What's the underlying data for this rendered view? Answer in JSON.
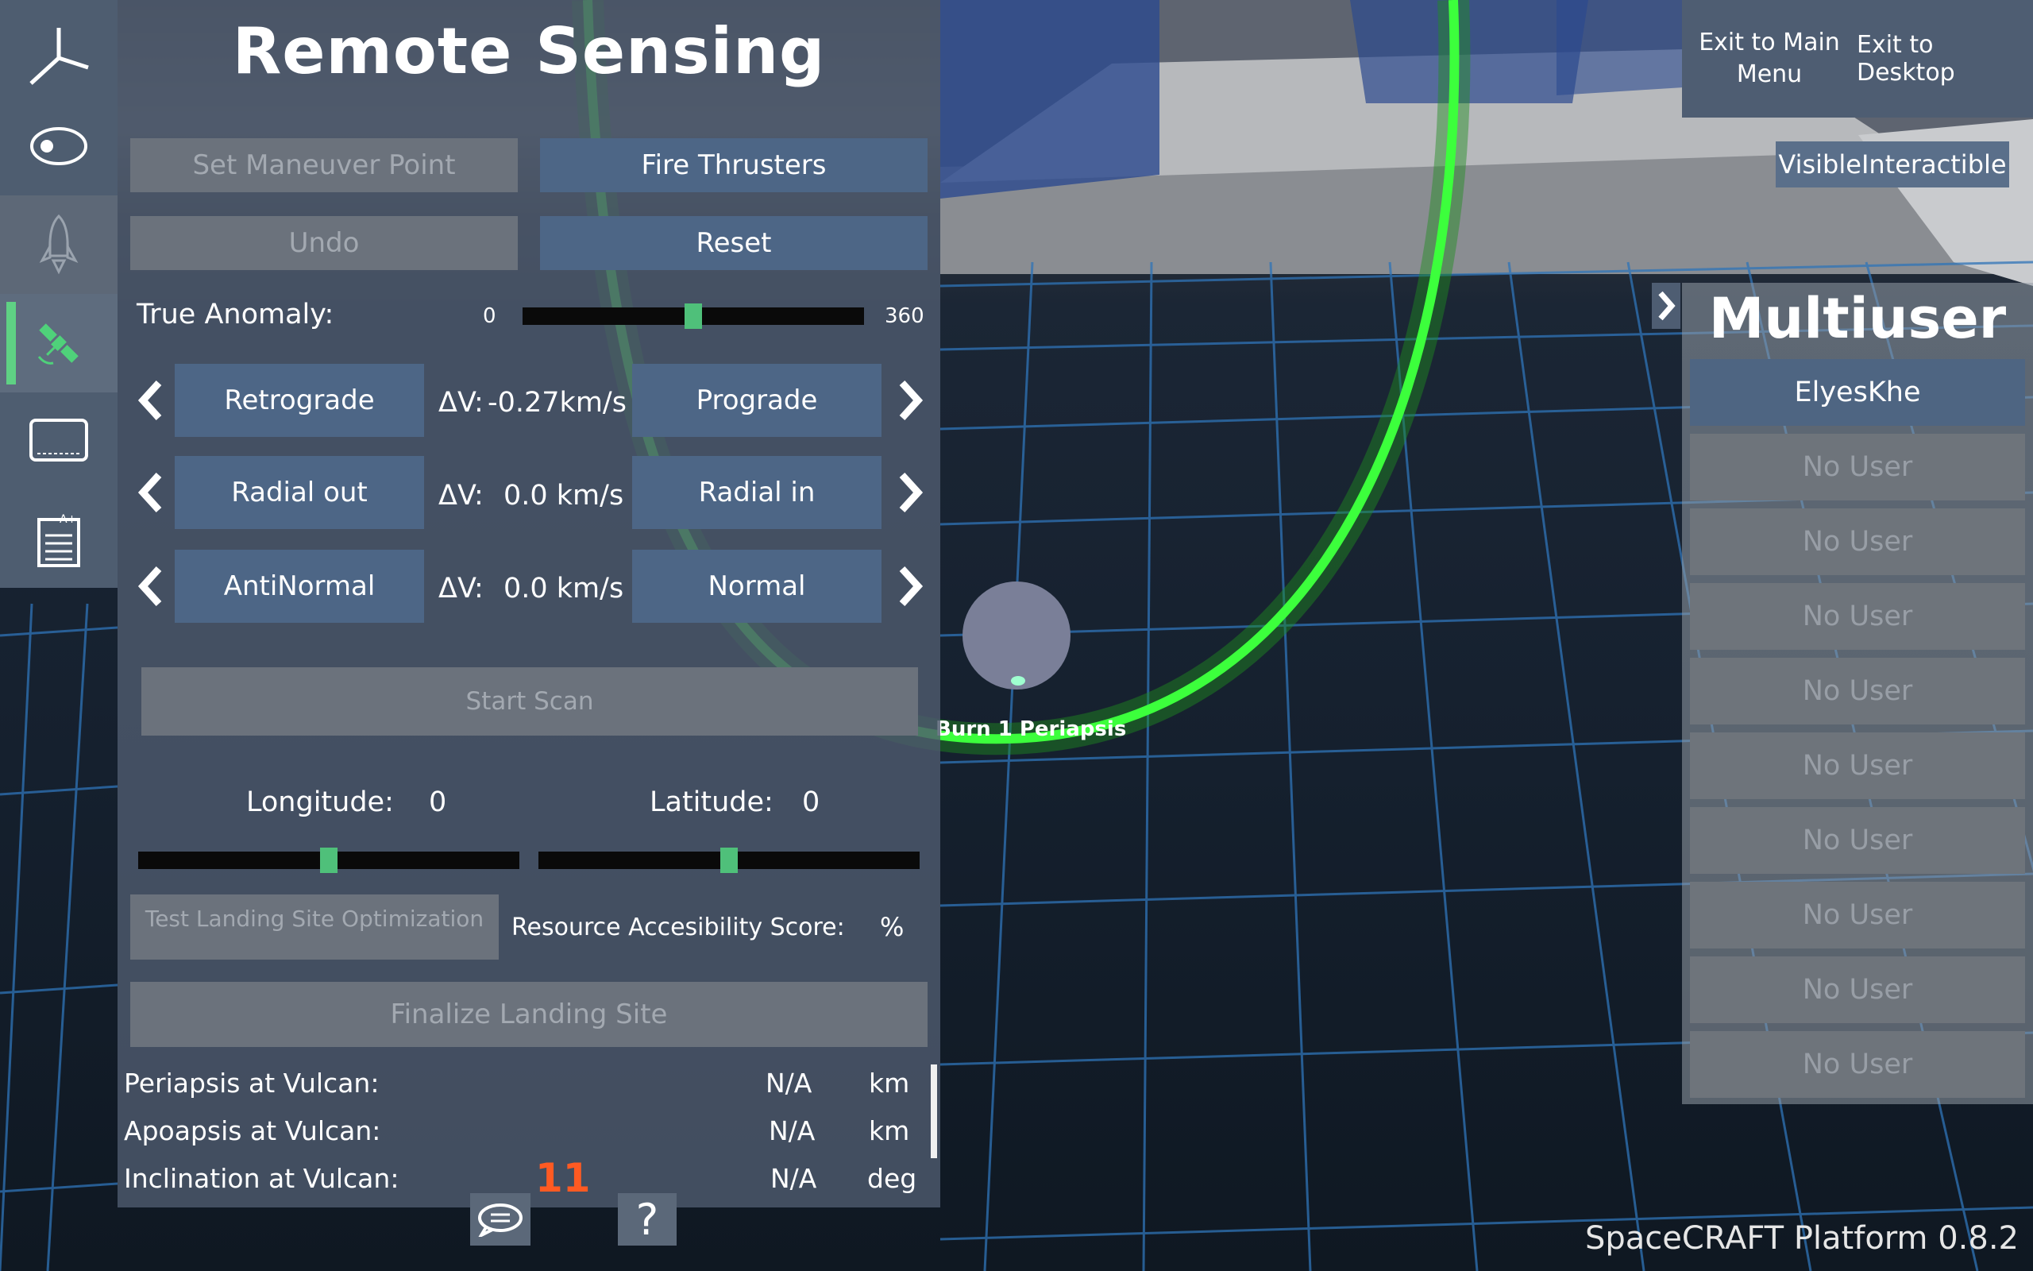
{
  "rail": {
    "items": [
      {
        "name": "axes"
      },
      {
        "name": "orbit"
      },
      {
        "name": "rocket"
      },
      {
        "name": "satellite"
      },
      {
        "name": "display"
      },
      {
        "name": "report"
      }
    ]
  },
  "panel": {
    "title": "Remote Sensing",
    "set_maneuver_label": "Set Maneuver Point",
    "fire_thrusters_label": "Fire Thrusters",
    "undo_label": "Undo",
    "reset_label": "Reset",
    "true_anomaly": {
      "label": "True Anomaly:",
      "min": "0",
      "max": "360",
      "value": 0.5
    },
    "burns": [
      {
        "left_label": "Retrograde",
        "dv_label": "ΔV:",
        "dv_value": "-0.27km/s",
        "right_label": "Prograde"
      },
      {
        "left_label": "Radial out",
        "dv_label": "ΔV:",
        "dv_value": "0.0 km/s",
        "right_label": "Radial in"
      },
      {
        "left_label": "AntiNormal",
        "dv_label": "ΔV:",
        "dv_value": "0.0 km/s",
        "right_label": "Normal"
      }
    ],
    "start_scan_label": "Start Scan",
    "longitude": {
      "label": "Longitude:",
      "value": "0",
      "position": 0.5
    },
    "latitude": {
      "label": "Latitude:",
      "value": "0",
      "position": 0.5
    },
    "test_landing_label": "Test Landing Site Optimization",
    "resource_score_label": "Resource Accesibility Score:",
    "resource_score_unit": "%",
    "finalize_label": "Finalize Landing Site",
    "stats": [
      {
        "label": "Periapsis at Vulcan:",
        "value": "N/A",
        "unit": "km"
      },
      {
        "label": "Apoapsis at Vulcan:",
        "value": "N/A",
        "unit": "km"
      },
      {
        "label": "Inclination at Vulcan:",
        "value": "N/A",
        "unit": "deg"
      }
    ],
    "chat_badge": "11",
    "help_label": "?"
  },
  "scene": {
    "marker_label": "Burn 1 Periapsis",
    "orbit_color": "#3cff3c"
  },
  "topmenu": {
    "exit_main_line1": "Exit to Main",
    "exit_main_line2": "Menu",
    "exit_desktop": "Exit to Desktop",
    "visible_interactible": "VisibleInteractible"
  },
  "multiuser": {
    "title": "Multiuser",
    "users": [
      "ElyesKhe",
      "No User",
      "No User",
      "No User",
      "No User",
      "No User",
      "No User",
      "No User",
      "No User",
      "No User"
    ]
  },
  "footer": {
    "version": "SpaceCRAFT Platform 0.8.2"
  }
}
